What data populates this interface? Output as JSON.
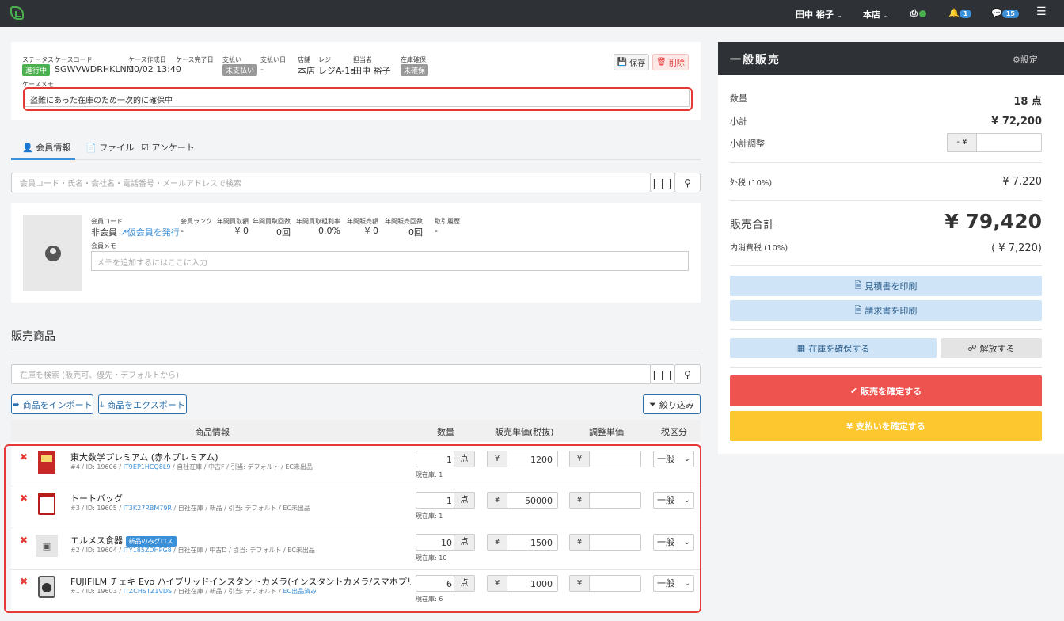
{
  "nav": {
    "user": "田中 裕子",
    "store": "本店",
    "bell_count": "1",
    "chat_count": "15"
  },
  "case": {
    "status_label": "ステータス",
    "status_value": "進行中",
    "code_label": "ケースコード",
    "code_value": "SGWVWDRHKLNM",
    "created_label": "ケース作成日",
    "created_value": "10/02 13:40",
    "completed_label": "ケース完了日",
    "completed_value": "-",
    "payment_label": "支払い",
    "payment_value": "未支払い",
    "paydate_label": "支払い日",
    "paydate_value": "-",
    "store_label": "店舗",
    "store_value": "本店",
    "register_label": "レジ",
    "register_value": "レジA-1a",
    "staff_label": "担当者",
    "staff_value": "田中 裕子",
    "stock_label": "在庫確保",
    "stock_value": "未確保",
    "memo_label": "ケースメモ",
    "memo_value": "盗難にあった在庫のため一次的に確保中",
    "save_label": "保存",
    "delete_label": "削除"
  },
  "tabs": [
    "会員情報",
    "ファイル",
    "アンケート"
  ],
  "member_search": {
    "placeholder": "会員コード・氏名・会社名・電話番号・メールアドレスで検索"
  },
  "member": {
    "code_label": "会員コード",
    "code_value": "非会員",
    "issue_link": "仮会員を発行",
    "rank_label": "会員ランク",
    "rank_value": "-",
    "buy_amount_label": "年間買取額",
    "buy_amount_value": "¥ 0",
    "buy_count_label": "年間買取回数",
    "buy_count_value": "0回",
    "margin_label": "年間買取粗利率",
    "margin_value": "0.0%",
    "sale_amount_label": "年間販売額",
    "sale_amount_value": "¥ 0",
    "sale_count_label": "年間販売回数",
    "sale_count_value": "0回",
    "history_label": "取引履歴",
    "history_value": "-",
    "memo_label": "会員メモ",
    "memo_placeholder": "メモを追加するにはここに入力"
  },
  "products": {
    "heading": "販売商品",
    "search_placeholder": "在庫を検索 (販売可、優先・デフォルトから)",
    "import_label": "商品をインポート",
    "export_label": "商品をエクスポート",
    "filter_label": "絞り込み",
    "columns": [
      "商品情報",
      "数量",
      "販売単価(税抜)",
      "調整単価",
      "税区分"
    ],
    "unit": "点",
    "yen": "¥",
    "tax_option": "一般",
    "items": [
      {
        "name": "東大数学プレミアム (赤本プレミアム)",
        "tag": "",
        "meta_pre": "#4 / ID: 19606 / ",
        "meta_link": "IT9EP1HCQ8L9",
        "meta_post": " / 自社在庫 / 中古F / 引当: デフォルト / ",
        "ec": "EC未出品",
        "qty": "1",
        "price": "1200",
        "stock": "現在庫: 1"
      },
      {
        "name": "トートバッグ",
        "tag": "",
        "meta_pre": "#3 / ID: 19605 / ",
        "meta_link": "IT3K27RBM79R",
        "meta_post": " / 自社在庫 / 新品 / 引当: デフォルト / ",
        "ec": "EC未出品",
        "qty": "1",
        "price": "50000",
        "stock": "現在庫: 1"
      },
      {
        "name": "エルメス食器",
        "tag": "新品のみグロス",
        "meta_pre": "#2 / ID: 19604 / ",
        "meta_link": "ITY185ZDHPG8",
        "meta_post": " / 自社在庫 / 中古D / 引当: デフォルト / ",
        "ec": "EC未出品",
        "qty": "10",
        "price": "1500",
        "stock": "現在庫: 10"
      },
      {
        "name": "FUJIFILM チェキ Evo ハイブリッドインスタントカメラ(インスタントカメラ/スマホプリンター/デジタルカメラ…",
        "tag": "",
        "meta_pre": "#1 / ID: 19603 / ",
        "meta_link": "ITZCHSTZ1VDS",
        "meta_post": " / 自社在庫 / 新品 / 引当: デフォルト / ",
        "ec": "EC出品済み",
        "qty": "6",
        "price": "1000",
        "stock": "現在庫: 6"
      }
    ]
  },
  "sale": {
    "title": "一般販売",
    "settings": "設定",
    "qty_label": "数量",
    "qty_value": "18 点",
    "subtotal_label": "小計",
    "subtotal_value": "¥ 72,200",
    "adjust_label": "小計調整",
    "adjust_prefix": "- ¥",
    "tax_label": "外税 (10%)",
    "tax_value": "¥ 7,220",
    "total_label": "販売合計",
    "total_value": "¥ 79,420",
    "intax_label": "内消費税 (10%)",
    "intax_value": "( ¥ 7,220)",
    "quote_label": "見積書を印刷",
    "invoice_label": "請求書を印刷",
    "reserve_label": "在庫を確保する",
    "release_label": "解放する",
    "confirm_sale_label": "販売を確定する",
    "confirm_pay_label": "¥ 支払いを確定する"
  },
  "colors": {
    "topbar": "#2e3136",
    "green": "#4caf50",
    "danger": "#ef5350",
    "warning": "#fdc72f",
    "light_blue": "#cfe4f6"
  }
}
